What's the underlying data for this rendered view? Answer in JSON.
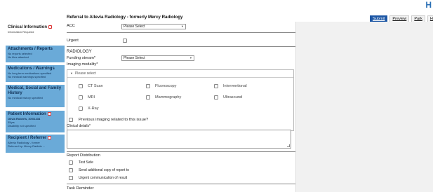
{
  "header": {
    "brand_letter": "H",
    "title": "Referral to Allevia Radiology - formerly Mercy Radiology",
    "actions": [
      "Submit",
      "Preview",
      "Park",
      "Help"
    ]
  },
  "sidebar": {
    "items": [
      {
        "heading": "Clinical Information",
        "sub": [
          "Information Required"
        ]
      },
      {
        "heading": "Attachments / Reports",
        "sub": [
          "No reports selected",
          "No files attached"
        ]
      },
      {
        "heading": "Medications / Warnings",
        "sub": [
          "No long term medications specified",
          "No medical warnings specified"
        ]
      },
      {
        "heading": "Medical, Social and Family History",
        "sub": [
          "No medical history specified"
        ]
      },
      {
        "heading": "Patient Information",
        "sub": [
          "Olivia Roberts, XXX1234",
          "35yrs",
          "Disability not specified"
        ]
      },
      {
        "heading": "Recipient / Referrer",
        "sub": [
          "Allevia Radiology - former",
          "Referred by: Mercy Radiolo ..."
        ]
      }
    ]
  },
  "form": {
    "acc_label": "ACC",
    "acc_select": "Please Select",
    "urgent_label": "Urgent",
    "radiology_label": "RADIOLOGY",
    "funding_label": "Funding stream*",
    "funding_select": "Please Select",
    "imaging_label": "Imaging modality*",
    "imaging_placeholder": "Please select",
    "modalities": [
      "CT Scan",
      "Fluoroscopy",
      "Interventional",
      "MRI",
      "Mammography",
      "Ultrasound",
      "X-Ray"
    ],
    "previous_imaging_label": "Previous imaging related to this issue?",
    "clinical_details_label": "Clinical details*",
    "report_distribution_label": "Report Distribution",
    "report_options": [
      "Test Safe",
      "Send additional copy of report to",
      "Urgent communication of result"
    ],
    "task_reminder_label": "Task Reminder"
  }
}
